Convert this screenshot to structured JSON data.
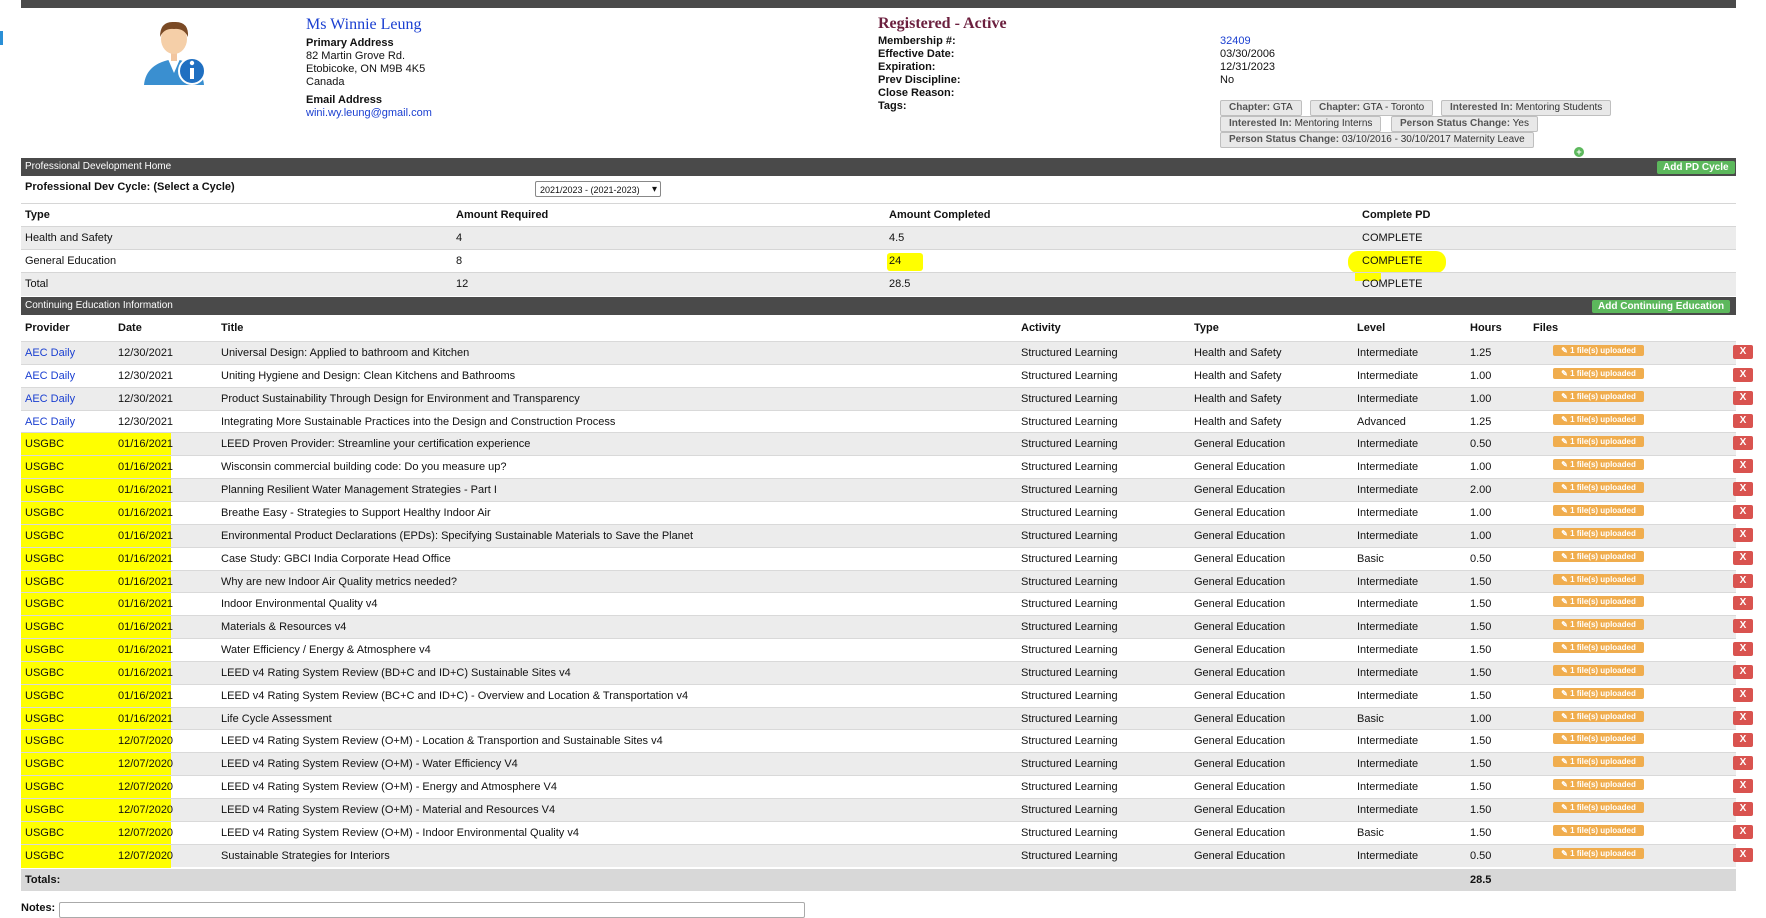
{
  "profile": {
    "name": "Ms Winnie Leung",
    "primary_address_label": "Primary Address",
    "address_line1": "82 Martin Grove Rd.",
    "address_line2": "Etobicoke, ON M9B 4K5",
    "address_line3": "Canada",
    "email_label": "Email Address",
    "email": "wini.wy.leung@gmail.com",
    "status": "Registered - Active",
    "membership_label": "Membership #:",
    "membership": "32409",
    "effective_label": "Effective Date:",
    "effective": "03/30/2006",
    "expiration_label": "Expiration:",
    "expiration": "12/31/2023",
    "prev_label": "Prev Discipline:",
    "prev": "No",
    "close_label": "Close Reason:",
    "tags_label": "Tags:",
    "tags": [
      {
        "key": "Chapter:",
        "val": "GTA"
      },
      {
        "key": "Chapter:",
        "val": "GTA - Toronto"
      },
      {
        "key": "Interested In:",
        "val": "Mentoring Students"
      },
      {
        "key": "Interested In:",
        "val": "Mentoring Interns"
      },
      {
        "key": "Person Status Change:",
        "val": "Yes"
      },
      {
        "key": "Person Status Change:",
        "val": "03/10/2016 - 30/10/2017 Maternity Leave"
      }
    ],
    "add_tag_icon": "+"
  },
  "pd": {
    "section_title": "Professional Development Home",
    "add_button": "Add PD Cycle",
    "cycle_label": "Professional Dev Cycle: (Select a Cycle)",
    "cycle_value": "2021/2023 - (2021-2023)",
    "headers": [
      "Type",
      "Amount Required",
      "Amount Completed",
      "Complete PD"
    ],
    "rows": [
      [
        "Health and Safety",
        "4",
        "4.5",
        "COMPLETE"
      ],
      [
        "General Education",
        "8",
        "24",
        "COMPLETE"
      ],
      [
        "Total",
        "12",
        "28.5",
        "COMPLETE"
      ]
    ]
  },
  "ce": {
    "section_title": "Continuing Education Information",
    "add_button": "Add Continuing Education",
    "headers": [
      "Provider",
      "Date",
      "Title",
      "Activity",
      "Type",
      "Level",
      "Hours",
      "Files"
    ],
    "file_badge": "✎ 1 file(s) uploaded",
    "delete_label": "X",
    "rows": [
      [
        "AEC Daily",
        "12/30/2021",
        "Universal Design: Applied to bathroom and Kitchen",
        "Structured Learning",
        "Health and Safety",
        "Intermediate",
        "1.25"
      ],
      [
        "AEC Daily",
        "12/30/2021",
        "Uniting Hygiene and Design: Clean Kitchens and Bathrooms",
        "Structured Learning",
        "Health and Safety",
        "Intermediate",
        "1.00"
      ],
      [
        "AEC Daily",
        "12/30/2021",
        "Product Sustainability Through Design for Environment and Transparency",
        "Structured Learning",
        "Health and Safety",
        "Intermediate",
        "1.00"
      ],
      [
        "AEC Daily",
        "12/30/2021",
        "Integrating More Sustainable Practices into the Design and Construction Process",
        "Structured Learning",
        "Health and Safety",
        "Advanced",
        "1.25"
      ],
      [
        "USGBC",
        "01/16/2021",
        "LEED Proven Provider: Streamline your certification experience",
        "Structured Learning",
        "General Education",
        "Intermediate",
        "0.50"
      ],
      [
        "USGBC",
        "01/16/2021",
        "Wisconsin commercial building code: Do you measure up?",
        "Structured Learning",
        "General Education",
        "Intermediate",
        "1.00"
      ],
      [
        "USGBC",
        "01/16/2021",
        "Planning Resilient Water Management Strategies - Part I",
        "Structured Learning",
        "General Education",
        "Intermediate",
        "2.00"
      ],
      [
        "USGBC",
        "01/16/2021",
        "Breathe Easy - Strategies to Support Healthy Indoor Air",
        "Structured Learning",
        "General Education",
        "Intermediate",
        "1.00"
      ],
      [
        "USGBC",
        "01/16/2021",
        "Environmental Product Declarations (EPDs): Specifying Sustainable Materials to Save the Planet",
        "Structured Learning",
        "General Education",
        "Intermediate",
        "1.00"
      ],
      [
        "USGBC",
        "01/16/2021",
        "Case Study: GBCI India Corporate Head Office",
        "Structured Learning",
        "General Education",
        "Basic",
        "0.50"
      ],
      [
        "USGBC",
        "01/16/2021",
        "Why are new Indoor Air Quality metrics needed?",
        "Structured Learning",
        "General Education",
        "Intermediate",
        "1.50"
      ],
      [
        "USGBC",
        "01/16/2021",
        "Indoor Environmental Quality v4",
        "Structured Learning",
        "General Education",
        "Intermediate",
        "1.50"
      ],
      [
        "USGBC",
        "01/16/2021",
        "Materials & Resources v4",
        "Structured Learning",
        "General Education",
        "Intermediate",
        "1.50"
      ],
      [
        "USGBC",
        "01/16/2021",
        "Water Efficiency / Energy & Atmosphere v4",
        "Structured Learning",
        "General Education",
        "Intermediate",
        "1.50"
      ],
      [
        "USGBC",
        "01/16/2021",
        "LEED v4 Rating System Review (BD+C and ID+C) Sustainable Sites v4",
        "Structured Learning",
        "General Education",
        "Intermediate",
        "1.50"
      ],
      [
        "USGBC",
        "01/16/2021",
        "LEED v4 Rating System Review (BC+C and ID+C) - Overview and Location & Transportation v4",
        "Structured Learning",
        "General Education",
        "Intermediate",
        "1.50"
      ],
      [
        "USGBC",
        "01/16/2021",
        "Life Cycle Assessment",
        "Structured Learning",
        "General Education",
        "Basic",
        "1.00"
      ],
      [
        "USGBC",
        "12/07/2020",
        "LEED v4 Rating System Review (O+M) - Location & Transportion and Sustainable Sites v4",
        "Structured Learning",
        "General Education",
        "Intermediate",
        "1.50"
      ],
      [
        "USGBC",
        "12/07/2020",
        "LEED v4 Rating System Review (O+M) - Water Efficiency V4",
        "Structured Learning",
        "General Education",
        "Intermediate",
        "1.50"
      ],
      [
        "USGBC",
        "12/07/2020",
        "LEED v4 Rating System Review (O+M) - Energy and Atmosphere V4",
        "Structured Learning",
        "General Education",
        "Intermediate",
        "1.50"
      ],
      [
        "USGBC",
        "12/07/2020",
        "LEED v4 Rating System Review (O+M) - Material and Resources V4",
        "Structured Learning",
        "General Education",
        "Intermediate",
        "1.50"
      ],
      [
        "USGBC",
        "12/07/2020",
        "LEED v4 Rating System Review (O+M) - Indoor Environmental Quality v4",
        "Structured Learning",
        "General Education",
        "Basic",
        "1.50"
      ],
      [
        "USGBC",
        "12/07/2020",
        "Sustainable Strategies for Interiors",
        "Structured Learning",
        "General Education",
        "Intermediate",
        "0.50"
      ]
    ],
    "totals_label": "Totals:",
    "totals_hours": "28.5"
  },
  "notes_label": "Notes:",
  "colors": {
    "highlight": "#ffff00",
    "header_bar": "#4a4a4a",
    "green": "#5cb85c",
    "orange": "#f0ad4e",
    "red": "#d9534f",
    "link": "#1a3fd1"
  }
}
